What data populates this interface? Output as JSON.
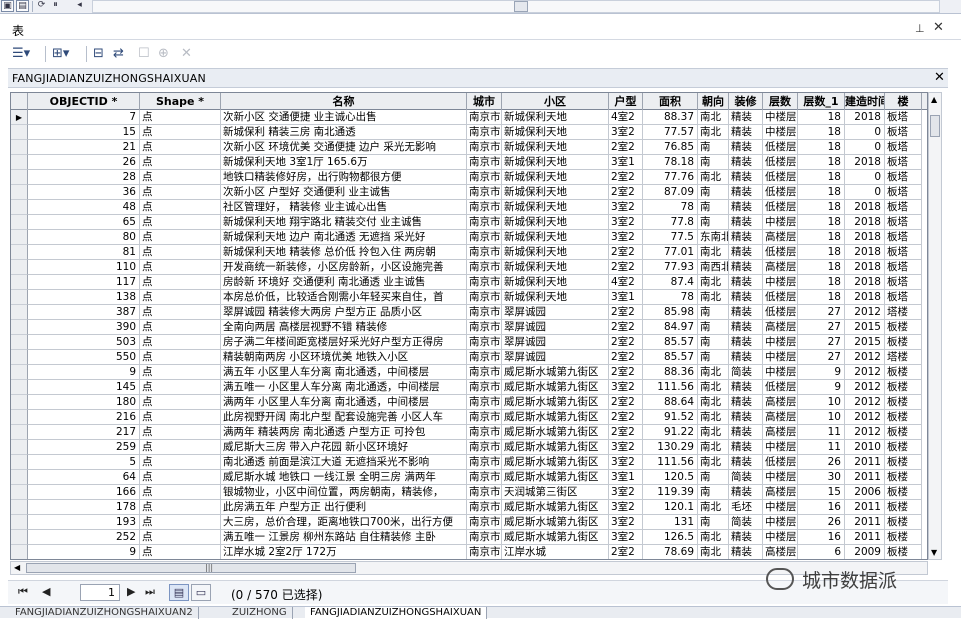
{
  "panel": {
    "title": "表",
    "pin_icon": "⊥",
    "close_icon": "✕"
  },
  "table_name": "FANGJIADIANZUIZHONGSHAIXUAN",
  "columns": [
    "OBJECTID *",
    "Shape *",
    "名称",
    "城市",
    "小区",
    "户型",
    "面积",
    "朝向",
    "装修",
    "层数",
    "层数_1",
    "建造时间",
    "楼"
  ],
  "rows": [
    [
      "7",
      "点",
      "次新小区  交通便捷  业主诚心出售",
      "南京市",
      "新城保利天地",
      "4室2",
      "88.37",
      "南北",
      "精装",
      "中楼层",
      "18",
      "2018",
      "板塔"
    ],
    [
      "15",
      "点",
      "新城保利     精装三房    南北通透",
      "南京市",
      "新城保利天地",
      "3室2",
      "77.57",
      "南北",
      "精装",
      "中楼层",
      "18",
      "0",
      "板塔"
    ],
    [
      "21",
      "点",
      "次新小区  环境优美  交通便捷  边户  采光无影响",
      "南京市",
      "新城保利天地",
      "2室2",
      "76.85",
      "南",
      "精装",
      "低楼层",
      "18",
      "0",
      "板塔"
    ],
    [
      "26",
      "点",
      "新城保利天地 3室1厅  165.6万",
      "南京市",
      "新城保利天地",
      "3室1",
      "78.18",
      "南",
      "精装",
      "低楼层",
      "18",
      "2018",
      "板塔"
    ],
    [
      "28",
      "点",
      "地铁口精装修好房，出行购物都很方便",
      "南京市",
      "新城保利天地",
      "2室2",
      "77.76",
      "南北",
      "精装",
      "低楼层",
      "18",
      "0",
      "板塔"
    ],
    [
      "36",
      "点",
      "次新小区  户型好  交通便利  业主诚售",
      "南京市",
      "新城保利天地",
      "2室2",
      "87.09",
      "南",
      "精装",
      "低楼层",
      "18",
      "0",
      "板塔"
    ],
    [
      "48",
      "点",
      "社区管理好，  精装修  业主诚心出售",
      "南京市",
      "新城保利天地",
      "3室2",
      "78",
      "南",
      "精装",
      "低楼层",
      "18",
      "2018",
      "板塔"
    ],
    [
      "65",
      "点",
      "新城保利天地  翔宇路北  精装交付  业主诚售",
      "南京市",
      "新城保利天地",
      "3室2",
      "77.8",
      "南",
      "精装",
      "中楼层",
      "18",
      "2018",
      "板塔"
    ],
    [
      "80",
      "点",
      "新城保利天地  边户  南北通透  无遮挡  采光好",
      "南京市",
      "新城保利天地",
      "3室2",
      "77.5",
      "东南北",
      "精装",
      "高楼层",
      "18",
      "2018",
      "板塔"
    ],
    [
      "81",
      "点",
      "新城保利天地  精装修  总价低  拎包入住  两房朝",
      "南京市",
      "新城保利天地",
      "2室2",
      "77.01",
      "南北",
      "精装",
      "低楼层",
      "18",
      "2018",
      "板塔"
    ],
    [
      "110",
      "点",
      "开发商统一新装修，小区房龄新，小区设施完善",
      "南京市",
      "新城保利天地",
      "2室2",
      "77.93",
      "南西北",
      "精装",
      "高楼层",
      "18",
      "2018",
      "板塔"
    ],
    [
      "117",
      "点",
      "房龄新    环境好    交通便利    南北通透  业主诚售",
      "南京市",
      "新城保利天地",
      "4室2",
      "87.4",
      "南北",
      "精装",
      "中楼层",
      "18",
      "2018",
      "板塔"
    ],
    [
      "138",
      "点",
      "本房总价低，比较适合刚需小年轻买来自住，首",
      "南京市",
      "新城保利天地",
      "3室1",
      "78",
      "南北",
      "精装",
      "低楼层",
      "18",
      "2018",
      "板塔"
    ],
    [
      "387",
      "点",
      "翠屏诚园  精装修大两房  户型方正  品质小区",
      "南京市",
      "翠屏诚园",
      "2室2",
      "85.98",
      "南",
      "精装",
      "低楼层",
      "27",
      "2012",
      "塔楼"
    ],
    [
      "390",
      "点",
      "全南向两居  高楼层视野不错  精装修",
      "南京市",
      "翠屏诚园",
      "2室2",
      "84.97",
      "南",
      "精装",
      "高楼层",
      "27",
      "2015",
      "板楼"
    ],
    [
      "503",
      "点",
      "房子满二年楼间距宽楼层好采光好户型方正得房",
      "南京市",
      "翠屏诚园",
      "2室2",
      "85.57",
      "南",
      "精装",
      "中楼层",
      "27",
      "2015",
      "板楼"
    ],
    [
      "550",
      "点",
      "精装朝南两房  小区环境优美  地铁入小区",
      "南京市",
      "翠屏诚园",
      "2室2",
      "85.57",
      "南",
      "精装",
      "中楼层",
      "27",
      "2012",
      "塔楼"
    ],
    [
      "9",
      "点",
      "满五年  小区里人车分离  南北通透，中间楼层",
      "南京市",
      "威尼斯水城第九街区",
      "2室2",
      "88.36",
      "南北",
      "简装",
      "中楼层",
      "9",
      "2012",
      "板楼"
    ],
    [
      "145",
      "点",
      "满五唯一  小区里人车分离  南北通透，中间楼层",
      "南京市",
      "威尼斯水城第九街区",
      "3室2",
      "111.56",
      "南北",
      "精装",
      "低楼层",
      "9",
      "2012",
      "板楼"
    ],
    [
      "180",
      "点",
      "满两年  小区里人车分离  南北通透，中间楼层",
      "南京市",
      "威尼斯水城第九街区",
      "2室2",
      "88.64",
      "南北",
      "精装",
      "高楼层",
      "10",
      "2012",
      "板楼"
    ],
    [
      "216",
      "点",
      "此房视野开阔  南北户型  配套设施完善  小区人车",
      "南京市",
      "威尼斯水城第九街区",
      "2室2",
      "91.52",
      "南北",
      "精装",
      "高楼层",
      "10",
      "2012",
      "板楼"
    ],
    [
      "217",
      "点",
      "满两年    精装两房  南北通透    户型方正    可拎包",
      "南京市",
      "威尼斯水城第九街区",
      "2室2",
      "91.22",
      "南北",
      "精装",
      "高楼层",
      "11",
      "2012",
      "板楼"
    ],
    [
      "259",
      "点",
      "威尼斯大三房  带入户花园    新小区环境好",
      "南京市",
      "威尼斯水城第九街区",
      "3室2",
      "130.29",
      "南北",
      "精装",
      "中楼层",
      "11",
      "2010",
      "板楼"
    ],
    [
      "5",
      "点",
      "南北通透  前面是滨江大道  无遮挡采光不影响",
      "南京市",
      "威尼斯水城第九街区",
      "3室2",
      "111.56",
      "南北",
      "精装",
      "低楼层",
      "26",
      "2011",
      "板楼"
    ],
    [
      "64",
      "点",
      "威尼斯水城  地铁口  一线江景  全明三房  满两年",
      "南京市",
      "威尼斯水城第九街区",
      "3室1",
      "120.5",
      "南",
      "简装",
      "中楼层",
      "30",
      "2011",
      "板楼"
    ],
    [
      "166",
      "点",
      "银城物业，小区中间位置，两房朝南，精装修，",
      "南京市",
      "天润城第三街区",
      "3室2",
      "119.39",
      "南",
      "精装",
      "高楼层",
      "15",
      "2006",
      "板楼"
    ],
    [
      "178",
      "点",
      "此房满五年  户型方正    出行便利",
      "南京市",
      "威尼斯水城第九街区",
      "3室2",
      "120.1",
      "南北",
      "毛坯",
      "中楼层",
      "16",
      "2011",
      "板楼"
    ],
    [
      "193",
      "点",
      "大三房，总价合理，距离地铁口700米，出行方便",
      "南京市",
      "威尼斯水城第九街区",
      "3室2",
      "131",
      "南",
      "简装",
      "中楼层",
      "26",
      "2011",
      "板楼"
    ],
    [
      "252",
      "点",
      "满五唯一  江景房  柳州东路站  自住精装修  主卧",
      "南京市",
      "威尼斯水城第九街区",
      "3室2",
      "126.5",
      "南北",
      "精装",
      "中楼层",
      "16",
      "2011",
      "板楼"
    ],
    [
      "9",
      "点",
      "江岸水城 2室2厅  172万",
      "南京市",
      "江岸水城",
      "2室2",
      "78.69",
      "南北",
      "精装",
      "高楼层",
      "6",
      "2009",
      "板楼"
    ]
  ],
  "nav": {
    "page": "1",
    "status": "(0 / 570 已选择)"
  },
  "watermark": "城市数据派",
  "bottom_tabs": [
    "FANGJIADIANZUIZHONGSHAIXUAN2",
    "ZUIZHONG",
    "FANGJIADIANZUIZHONGSHAIXUAN"
  ]
}
